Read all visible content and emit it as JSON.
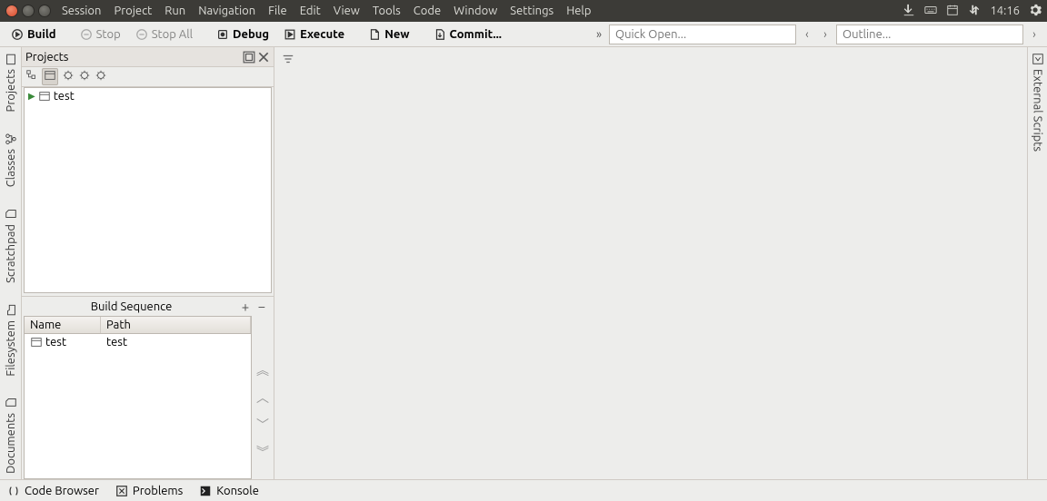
{
  "menubar": [
    "Session",
    "Project",
    "Run",
    "Navigation",
    "File",
    "Edit",
    "View",
    "Tools",
    "Code",
    "Window",
    "Settings",
    "Help"
  ],
  "clock": "14:16",
  "toolbar": {
    "build": "Build",
    "stop": "Stop",
    "stopall": "Stop All",
    "debug": "Debug",
    "execute": "Execute",
    "newbtn": "New",
    "commit": "Commit..."
  },
  "quick_open_placeholder": "Quick Open...",
  "outline_placeholder": "Outline...",
  "left_tabs": {
    "projects": "Projects",
    "classes": "Classes",
    "scratchpad": "Scratchpad",
    "filesystem": "Filesystem",
    "documents": "Documents"
  },
  "right_tabs": {
    "externalscripts": "External Scripts"
  },
  "projects_panel": {
    "title": "Projects"
  },
  "tree_item": "test",
  "build_sequence": {
    "title": "Build Sequence",
    "col_name": "Name",
    "col_path": "Path",
    "row": {
      "name": "test",
      "path": "test"
    }
  },
  "bottom": {
    "code_browser": "Code Browser",
    "problems": "Problems",
    "konsole": "Konsole"
  }
}
